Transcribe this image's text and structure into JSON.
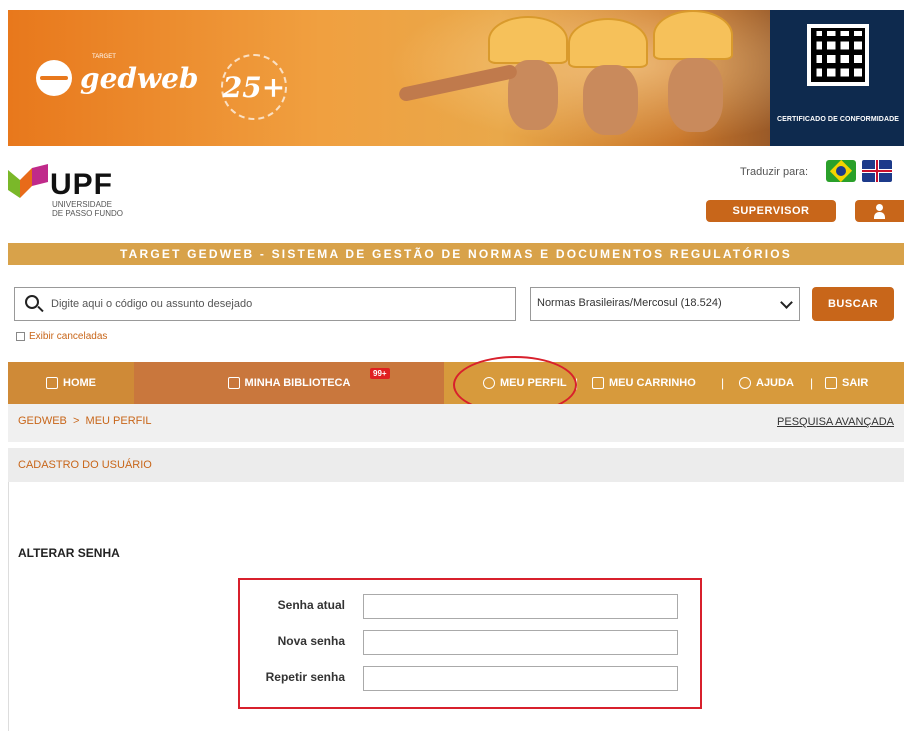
{
  "banner": {
    "logo_text": "gedweb",
    "logo_small": "TARGET",
    "badge": "25+",
    "cert_text": "CERTIFICADO DE CONFORMIDADE"
  },
  "institution": {
    "name": "UPF",
    "sub1": "UNIVERSIDADE",
    "sub2": "DE PASSO FUNDO"
  },
  "header": {
    "translate_label": "Traduzir para:",
    "supervisor_label": "SUPERVISOR"
  },
  "title_strip": "TARGET GEDWEB - SISTEMA DE GESTÃO DE NORMAS E DOCUMENTOS REGULATÓRIOS",
  "search": {
    "placeholder": "Digite aqui o código ou assunto desejado",
    "select_value": "Normas Brasileiras/Mercosul (18.524)",
    "button": "BUSCAR",
    "checkbox_label": "Exibir canceladas"
  },
  "nav": {
    "home": "HOME",
    "biblioteca": "MINHA BIBLIOTECA",
    "biblioteca_count": "99+",
    "perfil": "MEU PERFIL",
    "carrinho": "MEU CARRINHO",
    "ajuda": "AJUDA",
    "sair": "SAIR",
    "sep": "|"
  },
  "breadcrumb": {
    "path": "GEDWEB  >  MEU PERFIL",
    "advanced": "PESQUISA AVANÇADA"
  },
  "section": {
    "cadastro": "CADASTRO DO USUÁRIO",
    "alterar": "ALTERAR SENHA"
  },
  "form": {
    "senha_atual": "Senha atual",
    "nova_senha": "Nova senha",
    "repetir_senha": "Repetir senha"
  },
  "colors": {
    "accent": "#c8661a",
    "strip": "#d8a24a",
    "highlight": "#d8202c"
  }
}
